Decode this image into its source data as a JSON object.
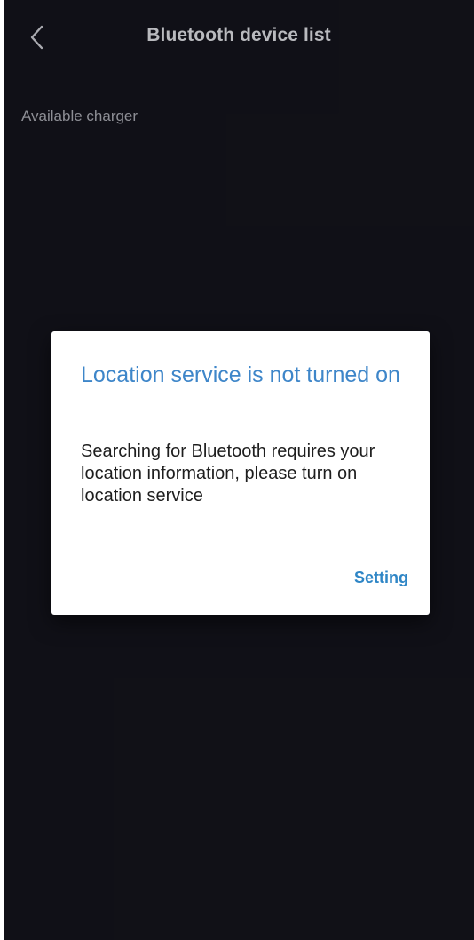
{
  "header": {
    "title": "Bluetooth device list",
    "back_icon": "chevron-left-icon"
  },
  "content": {
    "section_label": "Available charger"
  },
  "dialog": {
    "title": "Location service is not turned on",
    "message": "Searching for Bluetooth requires your location information, please turn on location service",
    "action_label": "Setting"
  },
  "colors": {
    "background": "#121219",
    "accent": "#3e86c9",
    "dialog_background": "#ffffff"
  }
}
